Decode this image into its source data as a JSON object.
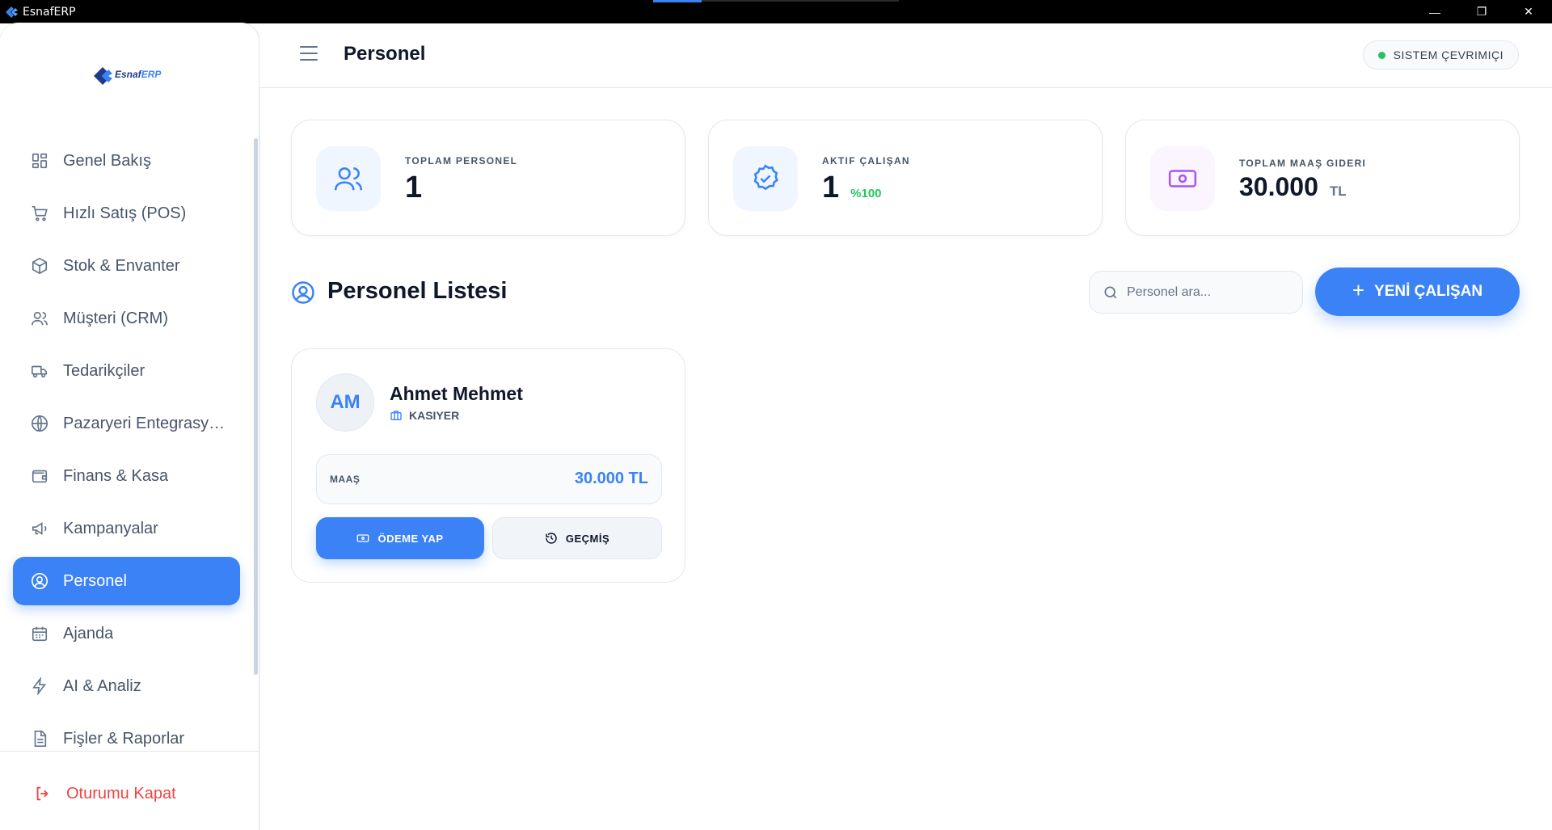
{
  "window": {
    "title": "EsnafERP",
    "minimize": "—",
    "maximize": "❐",
    "close": "✕"
  },
  "logo": {
    "part1": "Esnaf",
    "part2": "ERP"
  },
  "sidebar": {
    "items": [
      {
        "label": "Genel Bakış",
        "icon": "dashboard-icon"
      },
      {
        "label": "Hızlı Satış (POS)",
        "icon": "cart-icon"
      },
      {
        "label": "Stok & Envanter",
        "icon": "box-icon"
      },
      {
        "label": "Müşteri (CRM)",
        "icon": "users-icon"
      },
      {
        "label": "Tedarikçiler",
        "icon": "truck-icon"
      },
      {
        "label": "Pazaryeri Entegrasyonları",
        "icon": "globe-icon"
      },
      {
        "label": "Finans & Kasa",
        "icon": "wallet-icon"
      },
      {
        "label": "Kampanyalar",
        "icon": "megaphone-icon"
      },
      {
        "label": "Personel",
        "icon": "user-circle-icon",
        "active": true
      },
      {
        "label": "Ajanda",
        "icon": "calendar-icon"
      },
      {
        "label": "AI & Analiz",
        "icon": "bolt-icon"
      },
      {
        "label": "Fişler & Raporlar",
        "icon": "file-icon"
      }
    ],
    "logout": "Oturumu Kapat"
  },
  "header": {
    "title": "Personel",
    "status": "SISTEM ÇEVRIMIÇI"
  },
  "stats": [
    {
      "label": "TOPLAM PERSONEL",
      "value": "1",
      "sub": ""
    },
    {
      "label": "AKTIF ÇALIŞAN",
      "value": "1",
      "sub": "%100"
    },
    {
      "label": "TOPLAM MAAŞ GIDERI",
      "value": "30.000",
      "sub": "TL"
    }
  ],
  "section": {
    "title": "Personel Listesi",
    "search_placeholder": "Personel ara...",
    "new_button": "YENİ ÇALIŞAN"
  },
  "employees": [
    {
      "initials": "AM",
      "name": "Ahmet Mehmet",
      "role": "KASIYER",
      "salary_label": "MAAŞ",
      "salary_value": "30.000 TL",
      "pay_button": "ÖDEME YAP",
      "history_button": "GEÇMİŞ"
    }
  ],
  "colors": {
    "accent": "#3b82f6",
    "success": "#22c55e",
    "danger": "#ef4444",
    "purple": "#a855f7"
  }
}
